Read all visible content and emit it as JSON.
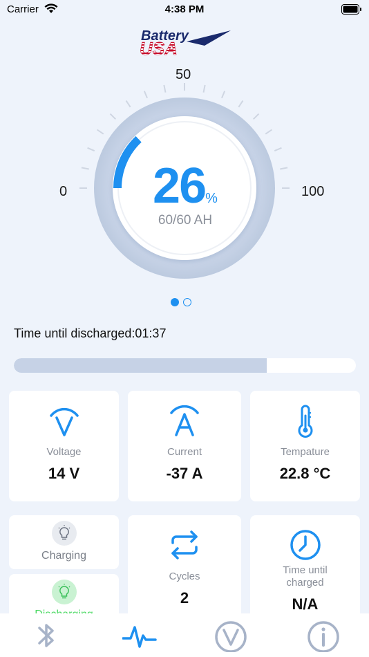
{
  "status_bar": {
    "carrier": "Carrier",
    "time": "4:38 PM"
  },
  "logo": {
    "line1": "Battery",
    "line2": "USA"
  },
  "gauge": {
    "label_min": "0",
    "label_mid": "50",
    "label_max": "100",
    "percent": "26",
    "percent_unit": "%",
    "capacity": "60/60 AH",
    "level_fraction": 0.26
  },
  "pager": {
    "count": 2,
    "active": 0
  },
  "discharge": {
    "text": "Time until discharged:01:37",
    "progress_fraction": 0.74
  },
  "cards": {
    "voltage": {
      "label": "Voltage",
      "value": "14 V"
    },
    "current": {
      "label": "Current",
      "value": "-37 A"
    },
    "temperature": {
      "label": "Tempature",
      "value": "22.8 °C"
    },
    "charging": {
      "label": "Charging"
    },
    "discharging": {
      "label": "Discharging"
    },
    "cycles": {
      "label": "Cycles",
      "value": "2"
    },
    "time_charged": {
      "label_line1": "Time until",
      "label_line2": "charged",
      "value": "N/A"
    }
  },
  "colors": {
    "accent": "#1e90f0",
    "ring": "#c6d2e6",
    "background": "#eef3fb",
    "muted_text": "#8a8f99",
    "active_green": "#4cd964"
  },
  "tabs": [
    {
      "icon": "bluetooth-icon"
    },
    {
      "icon": "pulse-icon",
      "active": true
    },
    {
      "icon": "voltage-circle-icon"
    },
    {
      "icon": "info-icon"
    }
  ]
}
